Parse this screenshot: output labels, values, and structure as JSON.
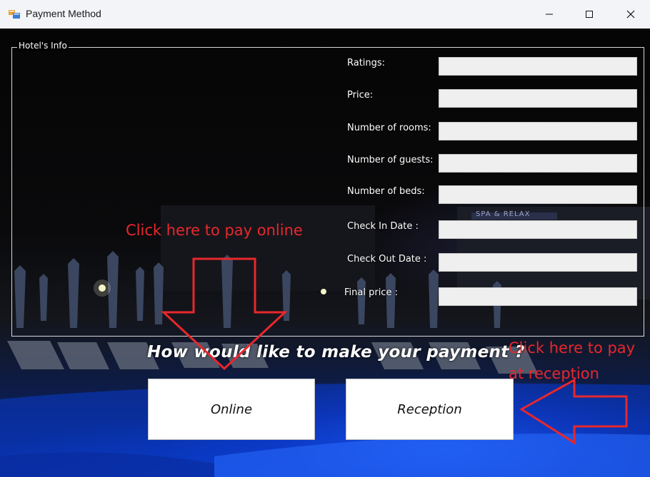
{
  "window": {
    "title": "Payment Method",
    "icon": "windows-form-icon"
  },
  "group": {
    "title": "Hotel's Info"
  },
  "fields": [
    {
      "label": "Ratings:",
      "value": ""
    },
    {
      "label": "Price:",
      "value": ""
    },
    {
      "label": "Number of rooms:",
      "value": ""
    },
    {
      "label": "Number of guests:",
      "value": ""
    },
    {
      "label": "Number of beds:",
      "value": ""
    },
    {
      "label": "Check In Date :",
      "value": ""
    },
    {
      "label": "Check Out Date :",
      "value": ""
    },
    {
      "label": "Final price :",
      "value": ""
    }
  ],
  "question": "How would like to make your payment ?",
  "buttons": {
    "online": "Online",
    "reception": "Reception"
  },
  "annotations": {
    "online": "Click here to pay online",
    "reception_line1": "Click here to pay",
    "reception_line2": "at reception"
  },
  "background_sign": "SPA & RELAX",
  "colors": {
    "annotation": "#e8272c",
    "input_bg": "#efefef",
    "pool_blue": "#1f5cff"
  }
}
